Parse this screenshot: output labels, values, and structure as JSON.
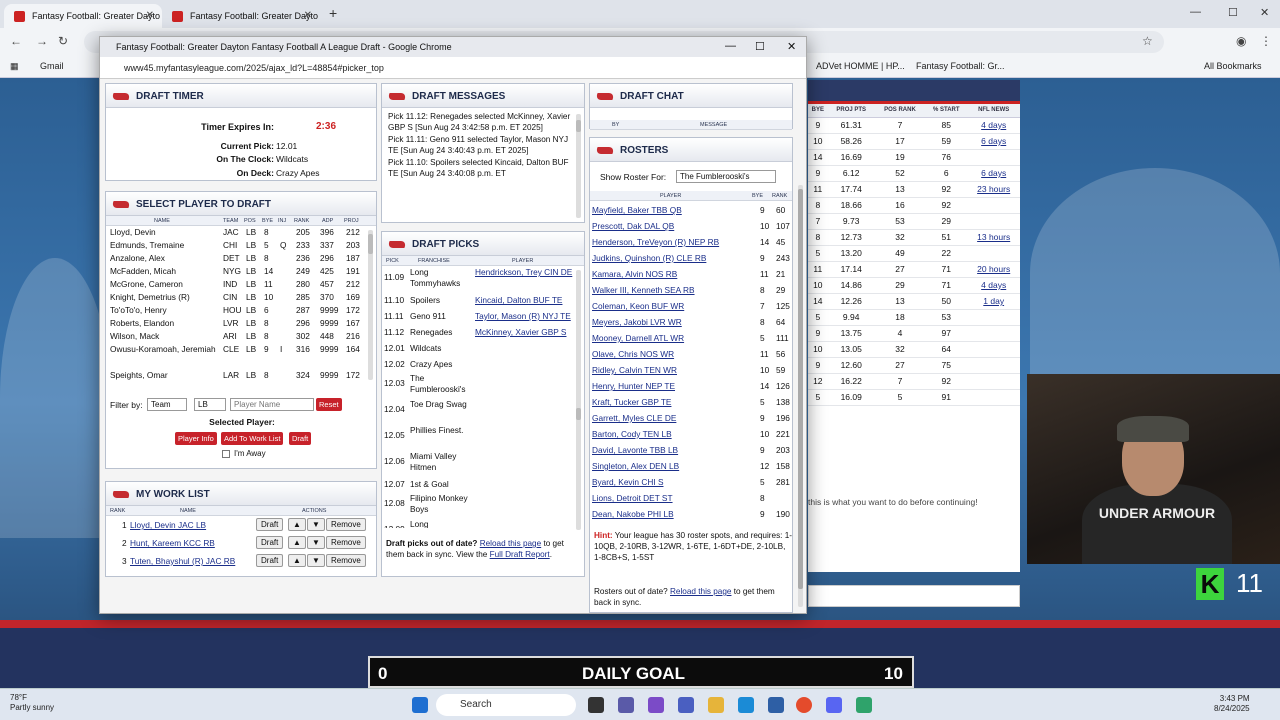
{
  "browser": {
    "tab1": "Fantasy Football: Greater Dayto",
    "tab2": "Fantasy Football: Greater Dayto",
    "bookmarks": [
      "Gmail",
      "ADVet HOMME | HP...",
      "Fantasy Football: Gr..."
    ],
    "all_bookmarks": "All Bookmarks"
  },
  "popup": {
    "title": "Fantasy Football: Greater Dayton Fantasy Football A League Draft - Google Chrome",
    "url": "www45.myfantasyleague.com/2025/ajax_ld?L=48854#picker_top"
  },
  "timer": {
    "title": "DRAFT TIMER",
    "expires_label": "Timer Expires In:",
    "expires_value": "2:36",
    "current_label": "Current Pick:",
    "current_value": "12.01",
    "clock_label": "On The Clock:",
    "clock_value": "Wildcats",
    "deck_label": "On Deck:",
    "deck_value": "Crazy Apes"
  },
  "select": {
    "title": "SELECT PLAYER TO DRAFT",
    "cols": [
      "NAME",
      "TEAM",
      "POS",
      "BYE",
      "INJ",
      "RANK",
      "ADP",
      "PROJ"
    ],
    "rows": [
      [
        "Lloyd, Devin",
        "JAC",
        "LB",
        "8",
        "",
        "205",
        "396",
        "212"
      ],
      [
        "Edmunds, Tremaine",
        "CHI",
        "LB",
        "5",
        "Q",
        "233",
        "337",
        "203"
      ],
      [
        "Anzalone, Alex",
        "DET",
        "LB",
        "8",
        "",
        "236",
        "296",
        "187"
      ],
      [
        "McFadden, Micah",
        "NYG",
        "LB",
        "14",
        "",
        "249",
        "425",
        "191"
      ],
      [
        "McGrone, Cameron",
        "IND",
        "LB",
        "11",
        "",
        "280",
        "457",
        "212"
      ],
      [
        "Knight, Demetrius (R)",
        "CIN",
        "LB",
        "10",
        "",
        "285",
        "370",
        "169"
      ],
      [
        "To'oTo'o, Henry",
        "HOU",
        "LB",
        "6",
        "",
        "287",
        "9999",
        "172"
      ],
      [
        "Roberts, Elandon",
        "LVR",
        "LB",
        "8",
        "",
        "296",
        "9999",
        "167"
      ],
      [
        "Wilson, Mack",
        "ARI",
        "LB",
        "8",
        "",
        "302",
        "448",
        "216"
      ],
      [
        "Owusu-Koramoah, Jeremiah",
        "CLE",
        "LB",
        "9",
        "I",
        "316",
        "9999",
        "164"
      ],
      [
        "Speights, Omar",
        "LAR",
        "LB",
        "8",
        "",
        "324",
        "9999",
        "172"
      ]
    ],
    "filter_label": "Filter by:",
    "team": "Team",
    "pos": "LB",
    "name_placeholder": "Player Name",
    "reset": "Reset",
    "selected_label": "Selected Player:",
    "player_info": "Player Info",
    "add_list": "Add To Work List",
    "draft": "Draft",
    "away": "I'm Away"
  },
  "worklist": {
    "title": "MY WORK LIST",
    "cols": [
      "RANK",
      "NAME",
      "ACTIONS"
    ],
    "rows": [
      [
        "1",
        "Lloyd, Devin JAC LB"
      ],
      [
        "2",
        "Hunt, Kareem KCC RB"
      ],
      [
        "3",
        "Tuten, Bhayshul (R) JAC RB"
      ]
    ],
    "draft": "Draft",
    "up": "▲",
    "down": "▼",
    "remove": "Remove"
  },
  "messages": {
    "title": "DRAFT MESSAGES",
    "items": [
      "Pick 11.12: Renegades selected McKinney, Xavier GBP S [Sun Aug 24 3:42:58 p.m. ET 2025]",
      "Pick 11.11: Geno 911 selected Taylor, Mason NYJ TE [Sun Aug 24 3:40:43 p.m. ET 2025]",
      "Pick 11.10: Spoilers selected Kincaid, Dalton BUF TE [Sun Aug 24 3:40:08 p.m. ET"
    ]
  },
  "picks": {
    "title": "DRAFT PICKS",
    "cols": [
      "PICK",
      "FRANCHISE",
      "PLAYER"
    ],
    "rows": [
      [
        "11.09",
        "Long Tommyhawks",
        "Hendrickson, Trey CIN DE"
      ],
      [
        "11.10",
        "Spoilers",
        "Kincaid, Dalton BUF TE"
      ],
      [
        "11.11",
        "Geno 911",
        "Taylor, Mason (R) NYJ TE"
      ],
      [
        "11.12",
        "Renegades",
        "McKinney, Xavier GBP S"
      ],
      [
        "12.01",
        "Wildcats",
        ""
      ],
      [
        "12.02",
        "Crazy Apes",
        ""
      ],
      [
        "12.03",
        "The Fumblerooski's",
        ""
      ],
      [
        "12.04",
        "Toe Drag Swag",
        ""
      ],
      [
        "12.05",
        "Phillies Finest.",
        ""
      ],
      [
        "12.06",
        "Miami Valley Hitmen",
        ""
      ],
      [
        "12.07",
        "1st & Goal",
        ""
      ],
      [
        "12.08",
        "Filipino Monkey Boys",
        ""
      ],
      [
        "12.09",
        "Long Tommyhawks",
        ""
      ]
    ],
    "foot1": "Draft picks out of date?",
    "foot_link": "Reload this page",
    "foot2": "to get them back in sync. View the",
    "foot_link2": "Full Draft Report"
  },
  "chat": {
    "title": "DRAFT CHAT",
    "cols": [
      "BY",
      "MESSAGE"
    ]
  },
  "rosters": {
    "title": "ROSTERS",
    "show_label": "Show Roster For:",
    "team": "The Fumblerooski's",
    "cols": [
      "PLAYER",
      "BYE",
      "RANK"
    ],
    "rows": [
      [
        "Mayfield, Baker TBB QB",
        "9",
        "60"
      ],
      [
        "Prescott, Dak DAL QB",
        "10",
        "107"
      ],
      [
        "Henderson, TreVeyon (R) NEP RB",
        "14",
        "45"
      ],
      [
        "Judkins, Quinshon (R) CLE RB",
        "9",
        "243"
      ],
      [
        "Kamara, Alvin NOS RB",
        "11",
        "21"
      ],
      [
        "Walker III, Kenneth SEA RB",
        "8",
        "29"
      ],
      [
        "Coleman, Keon BUF WR",
        "7",
        "125"
      ],
      [
        "Meyers, Jakobi LVR WR",
        "8",
        "64"
      ],
      [
        "Mooney, Darnell ATL WR",
        "5",
        "111"
      ],
      [
        "Olave, Chris NOS WR",
        "11",
        "56"
      ],
      [
        "Ridley, Calvin TEN WR",
        "10",
        "59"
      ],
      [
        "Henry, Hunter NEP TE",
        "14",
        "126"
      ],
      [
        "Kraft, Tucker GBP TE",
        "5",
        "138"
      ],
      [
        "Garrett, Myles CLE DE",
        "9",
        "196"
      ],
      [
        "Barton, Cody TEN LB",
        "10",
        "221"
      ],
      [
        "David, Lavonte TBB LB",
        "9",
        "203"
      ],
      [
        "Singleton, Alex DEN LB",
        "12",
        "158"
      ],
      [
        "Byard, Kevin CHI S",
        "5",
        "281"
      ],
      [
        "Lions, Detroit DET ST",
        "8",
        ""
      ],
      [
        "Dean, Nakobe PHI LB",
        "9",
        "190"
      ]
    ],
    "hint_label": "Hint:",
    "hint": "Your league has 30 roster spots, and requires: 1-10QB, 2-10RB, 3-12WR, 1-6TE, 1-6DT+DE, 2-10LB, 1-8CB+S, 1-5ST",
    "foot1": "Rosters out of date?",
    "foot_link": "Reload this page",
    "foot2": "to get them back in sync."
  },
  "bg": {
    "cols": [
      "BYE",
      "PROJ PTS",
      "POS RANK",
      "% START",
      "NFL NEWS"
    ],
    "rows": [
      [
        "9",
        "61.31",
        "7",
        "85",
        "4 days"
      ],
      [
        "10",
        "58.26",
        "17",
        "59",
        "6 days"
      ],
      [
        "14",
        "16.69",
        "19",
        "76",
        ""
      ],
      [
        "9",
        "6.12",
        "52",
        "6",
        "6 days"
      ],
      [
        "11",
        "17.74",
        "13",
        "92",
        "23 hours"
      ],
      [
        "8",
        "18.66",
        "16",
        "92",
        ""
      ],
      [
        "7",
        "9.73",
        "53",
        "29",
        ""
      ],
      [
        "8",
        "12.73",
        "32",
        "51",
        "13 hours"
      ],
      [
        "5",
        "13.20",
        "49",
        "22",
        ""
      ],
      [
        "11",
        "17.14",
        "27",
        "71",
        "20 hours"
      ],
      [
        "10",
        "14.86",
        "29",
        "71",
        "4 days"
      ],
      [
        "14",
        "12.26",
        "13",
        "50",
        "1 day"
      ],
      [
        "5",
        "9.94",
        "18",
        "53",
        ""
      ],
      [
        "9",
        "13.75",
        "4",
        "97",
        ""
      ],
      [
        "10",
        "13.05",
        "32",
        "64",
        ""
      ],
      [
        "9",
        "12.60",
        "27",
        "75",
        ""
      ],
      [
        "12",
        "16.22",
        "7",
        "92",
        ""
      ],
      [
        "5",
        "16.09",
        "5",
        "91",
        ""
      ]
    ],
    "msg": "this is what you want to do before continuing!"
  },
  "goal": {
    "left": "0",
    "label": "DAILY GOAL",
    "right": "10"
  },
  "stream": {
    "k": "K",
    "count": "11",
    "shirt": "UNDER ARMOUR"
  },
  "taskbar": {
    "temp": "78°F",
    "cond": "Partly sunny",
    "search": "Search",
    "time": "3:43 PM",
    "date": "8/24/2025"
  },
  "colors": {
    "accent": "#c52b30",
    "navy": "#23335f",
    "link": "#1a2e8a"
  }
}
